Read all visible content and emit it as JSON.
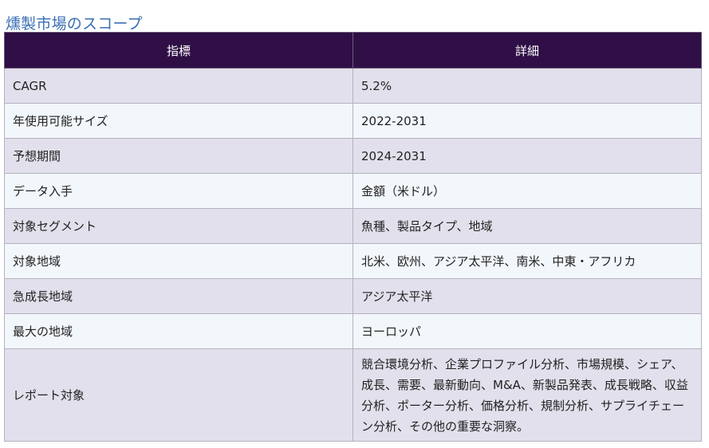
{
  "title": "燻製市場のスコープ",
  "table": {
    "headers": [
      "指標",
      "詳細"
    ],
    "rows": [
      {
        "metric": "CAGR",
        "detail": "5.2%"
      },
      {
        "metric": "年使用可能サイズ",
        "detail": "2022-2031"
      },
      {
        "metric": "予想期間",
        "detail": "2024-2031"
      },
      {
        "metric": "データ入手",
        "detail": "金額（米ドル）"
      },
      {
        "metric": "対象セグメント",
        "detail": "魚種、製品タイプ、地域"
      },
      {
        "metric": "対象地域",
        "detail": "北米、欧州、アジア太平洋、南米、中東・アフリカ"
      },
      {
        "metric": "急成長地域",
        "detail": "アジア太平洋"
      },
      {
        "metric": "最大の地域",
        "detail": "ヨーロッパ"
      },
      {
        "metric": "レポート対象",
        "detail": "競合環境分析、企業プロファイル分析、市場規模、シェア、成長、需要、最新動向、M&A、新製品発表、成長戦略、収益分析、ポーター分析、価格分析、規制分析、サプライチェーン分析、その他の重要な洞察。"
      }
    ]
  }
}
